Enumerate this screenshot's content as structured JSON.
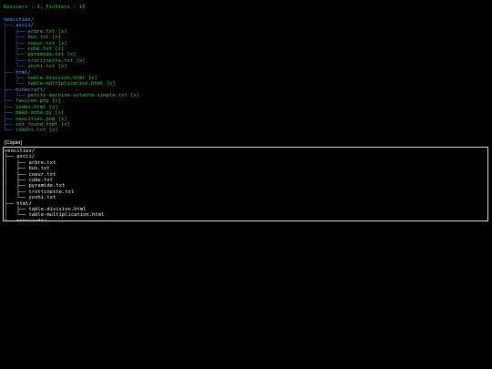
{
  "stats": "Dossiers : 3, Fichiers : 10",
  "tree": [
    {
      "prefix": "",
      "name": "neocities/",
      "kind": "dir",
      "suffix": ""
    },
    {
      "prefix": "├── ",
      "name": "ascii/",
      "kind": "dir",
      "suffix": ""
    },
    {
      "prefix": "│   ├── ",
      "name": "arbre.txt",
      "kind": "file",
      "suffix": " [x]"
    },
    {
      "prefix": "│   ├── ",
      "name": "bus.txt",
      "kind": "file",
      "suffix": " [x]"
    },
    {
      "prefix": "│   ├── ",
      "name": "coeur.txt",
      "kind": "file",
      "suffix": " [x]"
    },
    {
      "prefix": "│   ├── ",
      "name": "cube.txt",
      "kind": "file",
      "suffix": " [x]"
    },
    {
      "prefix": "│   ├── ",
      "name": "pyramide.txt",
      "kind": "file",
      "suffix": " [x]"
    },
    {
      "prefix": "│   ├── ",
      "name": "trottinette.txt",
      "kind": "file",
      "suffix": " [x]"
    },
    {
      "prefix": "│   └── ",
      "name": "yoshi.txt",
      "kind": "file",
      "suffix": " [x]"
    },
    {
      "prefix": "├── ",
      "name": "html/",
      "kind": "dir",
      "suffix": ""
    },
    {
      "prefix": "│   ├── ",
      "name": "table-division.html",
      "kind": "file",
      "suffix": " [x]"
    },
    {
      "prefix": "│   └── ",
      "name": "table-multiplication.html",
      "kind": "file",
      "suffix": " [x]"
    },
    {
      "prefix": "├── ",
      "name": "minecraft/",
      "kind": "dir",
      "suffix": ""
    },
    {
      "prefix": "│   └── ",
      "name": "petite-machine-volante-simple.txt",
      "kind": "file",
      "suffix": " [x]"
    },
    {
      "prefix": "├── ",
      "name": "favicon.png",
      "kind": "file",
      "suffix": " [x]"
    },
    {
      "prefix": "├── ",
      "name": "index.html",
      "kind": "file",
      "suffix": " [x]"
    },
    {
      "prefix": "├── ",
      "name": "make-arbo.py",
      "kind": "file",
      "suffix": " [x]"
    },
    {
      "prefix": "├── ",
      "name": "neocities.png",
      "kind": "file",
      "suffix": " [x]"
    },
    {
      "prefix": "├── ",
      "name": "not_found.html",
      "kind": "file",
      "suffix": " [x]"
    },
    {
      "prefix": "└── ",
      "name": "robots.txt",
      "kind": "file",
      "suffix": " [x]"
    }
  ],
  "copy_button": "[Copier]",
  "textbox_lines": [
    "neocities/",
    "├── ascii/",
    "│   ├── arbre.txt",
    "│   ├── bus.txt",
    "│   ├── coeur.txt",
    "│   ├── cube.txt",
    "│   ├── pyramide.txt",
    "│   ├── trottinette.txt",
    "│   └── yoshi.txt",
    "├── html/",
    "│   ├── table-division.html",
    "│   └── table-multiplication.html",
    "├── minecraft/"
  ],
  "colors": {
    "background": "#000000",
    "file": "#2ecc40",
    "directory": "#4da3ff",
    "branch": "#2e7be8",
    "textbox_text": "#f0f0f0"
  }
}
